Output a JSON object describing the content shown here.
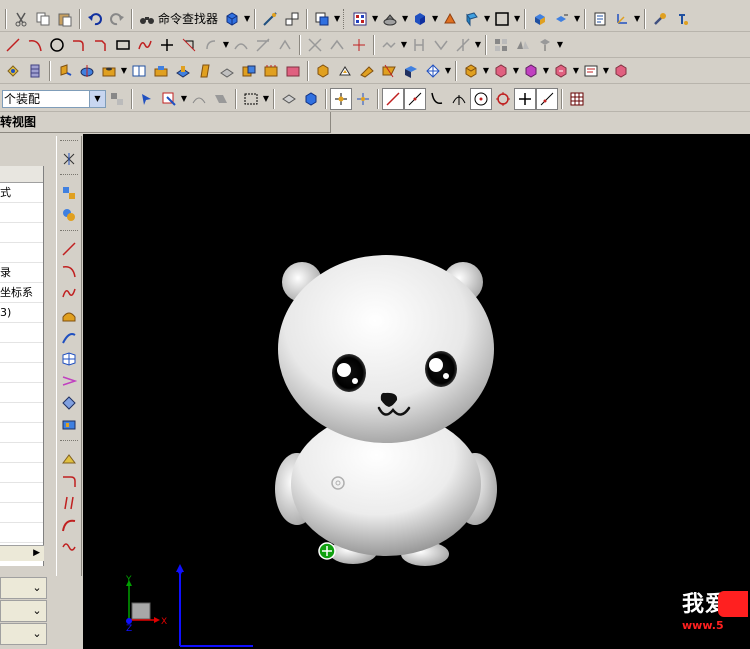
{
  "toolbar1": {
    "command_finder_label": "命令查找器"
  },
  "toolbar4": {
    "assembly_filter_value": "个装配"
  },
  "panel": {
    "title": "转视图"
  },
  "navigator": {
    "rows": [
      "式",
      "",
      "",
      "",
      "录",
      "坐标系",
      "3)",
      "",
      "",
      "",
      "",
      "",
      "",
      "",
      "",
      "",
      "",
      ""
    ]
  },
  "watermark": {
    "text": "我爱",
    "url": "www.5"
  },
  "axes": {
    "x_label": "X",
    "y_label": "Y",
    "z_label": "Z"
  },
  "colors": {
    "toolbar_bg": "#d4d0c8",
    "graphics_bg": "#000000",
    "axis_blue": "#1010ff",
    "axis_green": "#00a000",
    "axis_red": "#e00000"
  }
}
